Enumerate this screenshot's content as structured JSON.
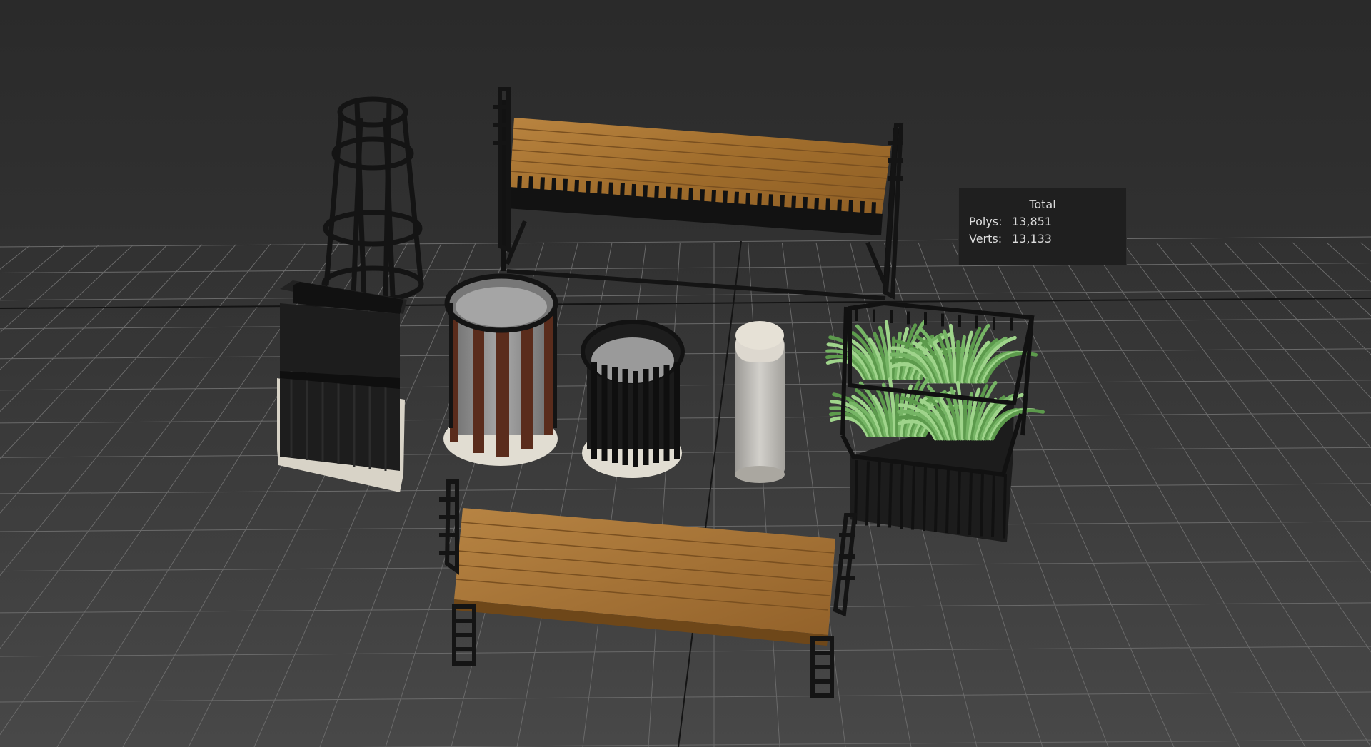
{
  "viewport": {
    "background_top": "#2a2a2a",
    "background_bottom": "#484848",
    "grid_color": "#6a6a6a",
    "axis_color": "#111111"
  },
  "stats": {
    "title": "Total",
    "polys_label": "Polys:",
    "polys_value": "13,851",
    "verts_label": "Verts:",
    "verts_value": "13,133"
  },
  "objects": [
    {
      "name": "bench-back",
      "material": "wood",
      "color": "#a9752f"
    },
    {
      "name": "bench-front",
      "material": "wood",
      "color": "#a9752f"
    },
    {
      "name": "planter-square-left",
      "material": "metal",
      "color": "#1c1c1c"
    },
    {
      "name": "obelisk-trellis",
      "material": "metal",
      "color": "#1a1a1a"
    },
    {
      "name": "waste-bin-wood",
      "material": "wood-metal",
      "color": "#5a2c1c"
    },
    {
      "name": "waste-bin-metal",
      "material": "metal",
      "color": "#1a1a1a"
    },
    {
      "name": "bollard",
      "material": "stone",
      "color": "#c9c6bf"
    },
    {
      "name": "planter-grass",
      "material": "metal-plant",
      "color": "#6ea95c"
    }
  ]
}
